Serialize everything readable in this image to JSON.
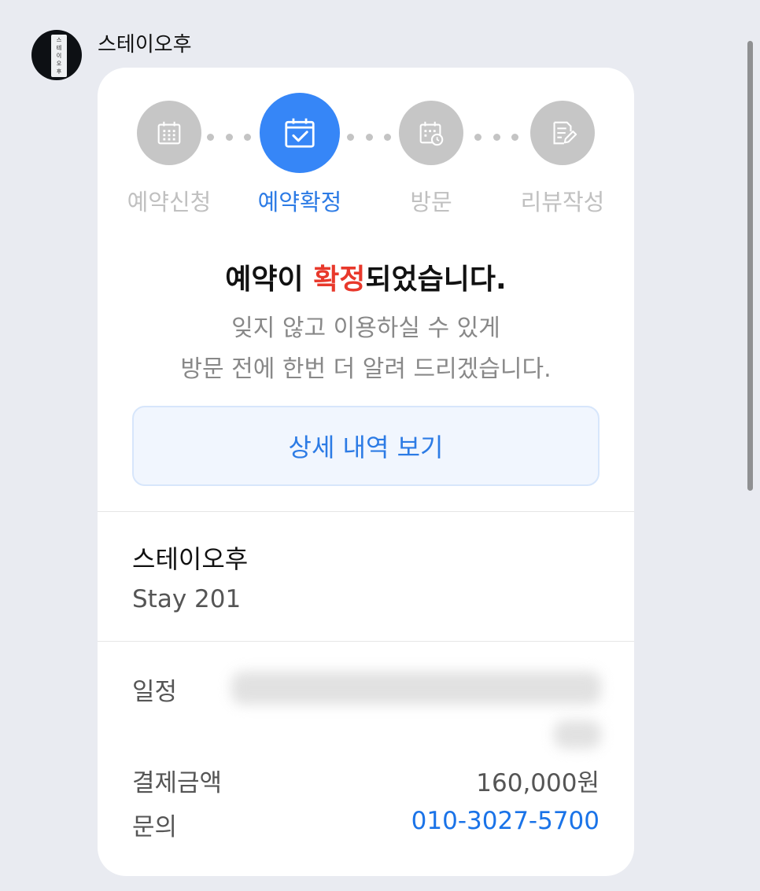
{
  "sender": {
    "name": "스테이오후",
    "avatar_text": "스테이오후"
  },
  "steps": [
    {
      "label": "예약신청",
      "icon": "calendar-grid-icon",
      "state": "inactive"
    },
    {
      "label": "예약확정",
      "icon": "calendar-check-icon",
      "state": "active"
    },
    {
      "label": "방문",
      "icon": "calendar-clock-icon",
      "state": "inactive"
    },
    {
      "label": "리뷰작성",
      "icon": "edit-note-icon",
      "state": "inactive"
    }
  ],
  "headline": {
    "prefix": "예약이 ",
    "highlight": "확정",
    "suffix": "되었습니다."
  },
  "description": {
    "line1": "잊지 않고 이용하실 수 있게",
    "line2": "방문 전에 한번 더 알려 드리겠습니다."
  },
  "detail_button": "상세 내역 보기",
  "shop": {
    "name": "스테이오후",
    "room": "Stay 201"
  },
  "details": {
    "schedule_label": "일정",
    "payment_label": "결제금액",
    "payment_value": "160,000원",
    "contact_label": "문의",
    "contact_value": "010-3027-5700"
  },
  "colors": {
    "accent": "#3686f7",
    "highlight_red": "#e8382b",
    "link": "#1a73e8",
    "inactive": "#c6c6c6",
    "background": "#e9ebf1"
  }
}
